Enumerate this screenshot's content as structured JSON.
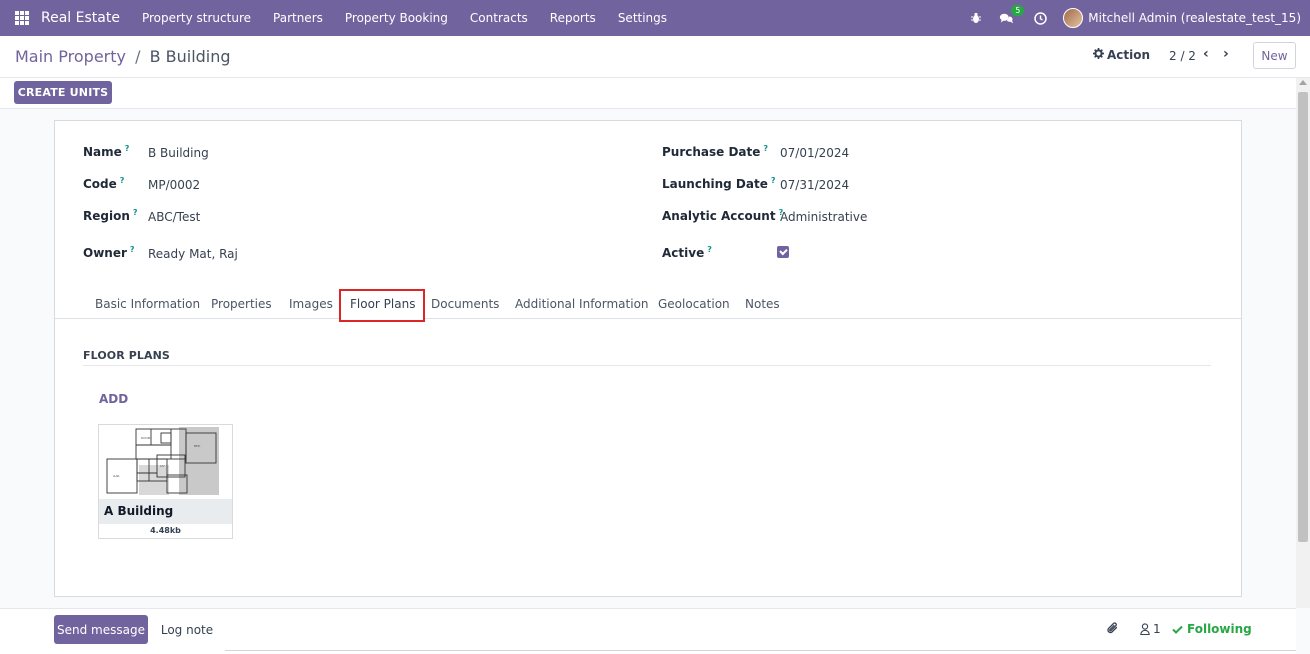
{
  "navbar": {
    "brand": "Real Estate",
    "menu": [
      "Property structure",
      "Partners",
      "Property Booking",
      "Contracts",
      "Reports",
      "Settings"
    ],
    "messages_badge": "5",
    "user": "Mitchell Admin (realestate_test_15)"
  },
  "breadcrumb": {
    "parent": "Main Property",
    "separator": "/",
    "current": "B Building"
  },
  "control": {
    "action_label": "Action",
    "pager": "2 / 2",
    "new_label": "New"
  },
  "statusbar": {
    "create_units_label": "CREATE UNITS"
  },
  "form": {
    "left_fields": [
      {
        "label": "Name",
        "value": "B Building"
      },
      {
        "label": "Code",
        "value": "MP/0002"
      },
      {
        "label": "Region",
        "value": "ABC/Test"
      },
      {
        "label": "Owner",
        "value": "Ready Mat, Raj"
      }
    ],
    "right_fields": [
      {
        "label": "Purchase Date",
        "value": "07/01/2024"
      },
      {
        "label": "Launching Date",
        "value": "07/31/2024"
      },
      {
        "label": "Analytic Account",
        "value": "Administrative"
      },
      {
        "label": "Active",
        "value": ""
      }
    ],
    "help_mark": "?",
    "active_checked": true
  },
  "tabs": [
    "Basic Information",
    "Properties",
    "Images",
    "Floor Plans",
    "Documents",
    "Additional Information",
    "Geolocation",
    "Notes"
  ],
  "active_tab": "Floor Plans",
  "floor_plans": {
    "section_title": "FLOOR PLANS",
    "add_label": "ADD",
    "items": [
      {
        "name": "A Building",
        "size": "4.48kb"
      }
    ]
  },
  "chatter": {
    "send_message_label": "Send message",
    "log_note_label": "Log note",
    "followers_count": "1",
    "following_label": "Following"
  },
  "colors": {
    "brand": "#71639e",
    "highlight": "#dc2626",
    "following": "#28a745"
  }
}
